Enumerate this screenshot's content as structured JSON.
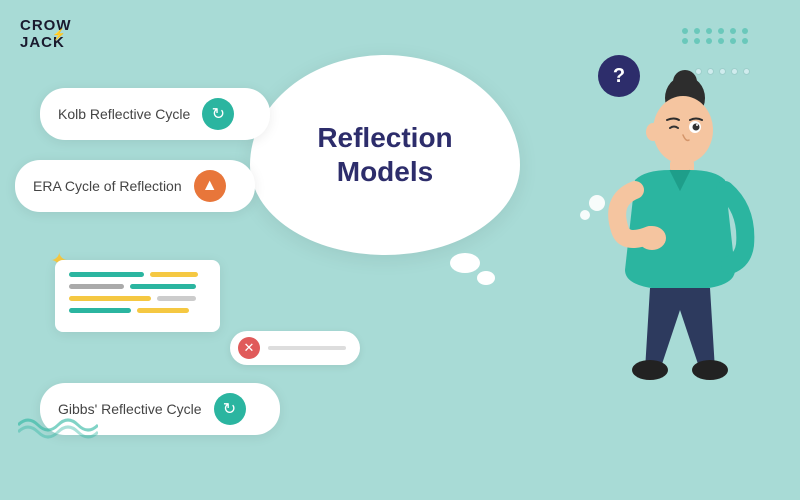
{
  "logo": {
    "line1": "CROW",
    "line2": "JACK"
  },
  "main_bubble": {
    "title_line1": "Reflection",
    "title_line2": "Models"
  },
  "buttons": [
    {
      "id": "kolb",
      "label": "Kolb Reflective Cycle",
      "icon_type": "refresh"
    },
    {
      "id": "era",
      "label": "ERA Cycle of Reflection",
      "icon_type": "triangle"
    },
    {
      "id": "gibbs",
      "label": "Gibbs' Reflective Cycle",
      "icon_type": "refresh"
    }
  ],
  "cancel_pill": {
    "line_label": ""
  },
  "icons": {
    "question_mark": "?",
    "sparkle": "✦",
    "refresh": "↻",
    "triangle": "▲",
    "close": "✕"
  },
  "ui_card": {
    "rows": [
      {
        "color1": "#2bb5a0",
        "width1": "60%",
        "color2": "#f5c842",
        "width2": "30%"
      },
      {
        "color1": "#aaa",
        "width1": "40%",
        "color2": "#2bb5a0",
        "width2": "45%"
      },
      {
        "color1": "#f5c842",
        "width1": "55%",
        "color2": "#aaa",
        "width2": "30%"
      }
    ]
  }
}
